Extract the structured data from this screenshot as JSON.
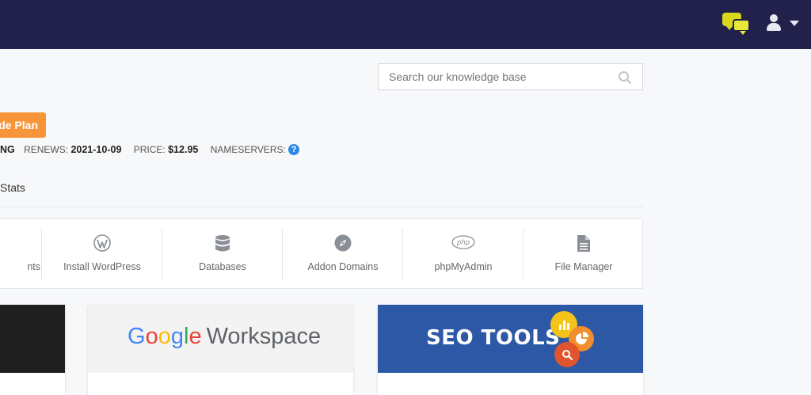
{
  "header": {
    "chat_icon": "chat-bubbles-icon",
    "user_icon": "user-icon",
    "dropdown_icon": "caret-down-icon",
    "accent": "#e2e22a",
    "bg": "#21214b"
  },
  "search": {
    "placeholder": "Search our knowledge base",
    "icon": "search-icon"
  },
  "plan": {
    "upgrade_label": "de Plan",
    "upgrade_color": "#f7953a"
  },
  "account_info": {
    "status_partial": "NG",
    "renews_label": "RENEWS:",
    "renews_value": "2021-10-09",
    "price_label": "PRICE:",
    "price_value": "$12.95",
    "nameservers_label": "NAMESERVERS:",
    "help_glyph": "?"
  },
  "tabs": {
    "stats_label": "Stats"
  },
  "tools": [
    {
      "label": "nts",
      "icon": "accounts-icon"
    },
    {
      "label": "Install WordPress",
      "icon": "wordpress-icon"
    },
    {
      "label": "Databases",
      "icon": "database-icon"
    },
    {
      "label": "Addon Domains",
      "icon": "compass-icon"
    },
    {
      "label": "phpMyAdmin",
      "icon": "php-icon"
    },
    {
      "label": "File Manager",
      "icon": "file-icon"
    }
  ],
  "promos": {
    "google": {
      "brand": [
        "G",
        "o",
        "o",
        "g",
        "l",
        "e"
      ],
      "product": "Workspace"
    },
    "seo": {
      "title": "SEO TOOLS"
    }
  }
}
